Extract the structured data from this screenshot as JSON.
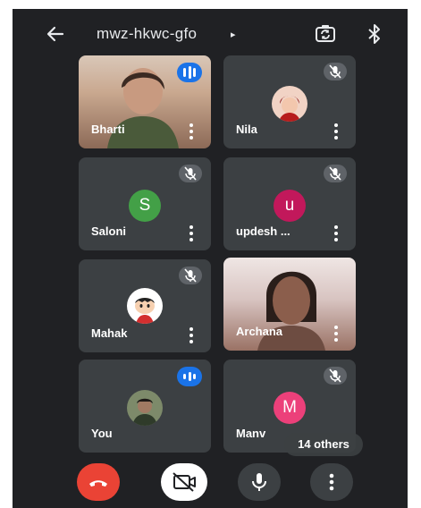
{
  "header": {
    "meeting_code": "mwz-hkwc-gfo",
    "caret": "▸",
    "icons": [
      "arrow-left-icon",
      "camera-flip-icon",
      "bluetooth-icon"
    ]
  },
  "participants": [
    {
      "name": "Bharti",
      "status": "speaking",
      "media": "video"
    },
    {
      "name": "Nila",
      "status": "muted",
      "media": "avatar-photo"
    },
    {
      "name": "Saloni",
      "status": "muted",
      "media": "letter",
      "letter": "S",
      "color": "#43a047"
    },
    {
      "name": "updesh ...",
      "status": "muted",
      "media": "letter",
      "letter": "u",
      "color": "#c2185b"
    },
    {
      "name": "Mahak",
      "status": "muted",
      "media": "avatar-photo"
    },
    {
      "name": "Archana",
      "status": "none",
      "media": "video"
    },
    {
      "name": "You",
      "status": "speaking",
      "media": "avatar-photo"
    },
    {
      "name": "Manv",
      "status": "muted",
      "media": "letter",
      "letter": "M",
      "color": "#ec407a"
    }
  ],
  "others_badge": "14 others",
  "controls": [
    "end-call-button",
    "camera-off-button",
    "microphone-button",
    "more-options-button"
  ],
  "colors": {
    "end_call": "#ea4335",
    "speaking": "#1a73e8",
    "tile_bg": "#3c4043",
    "screen_bg": "#202124"
  }
}
